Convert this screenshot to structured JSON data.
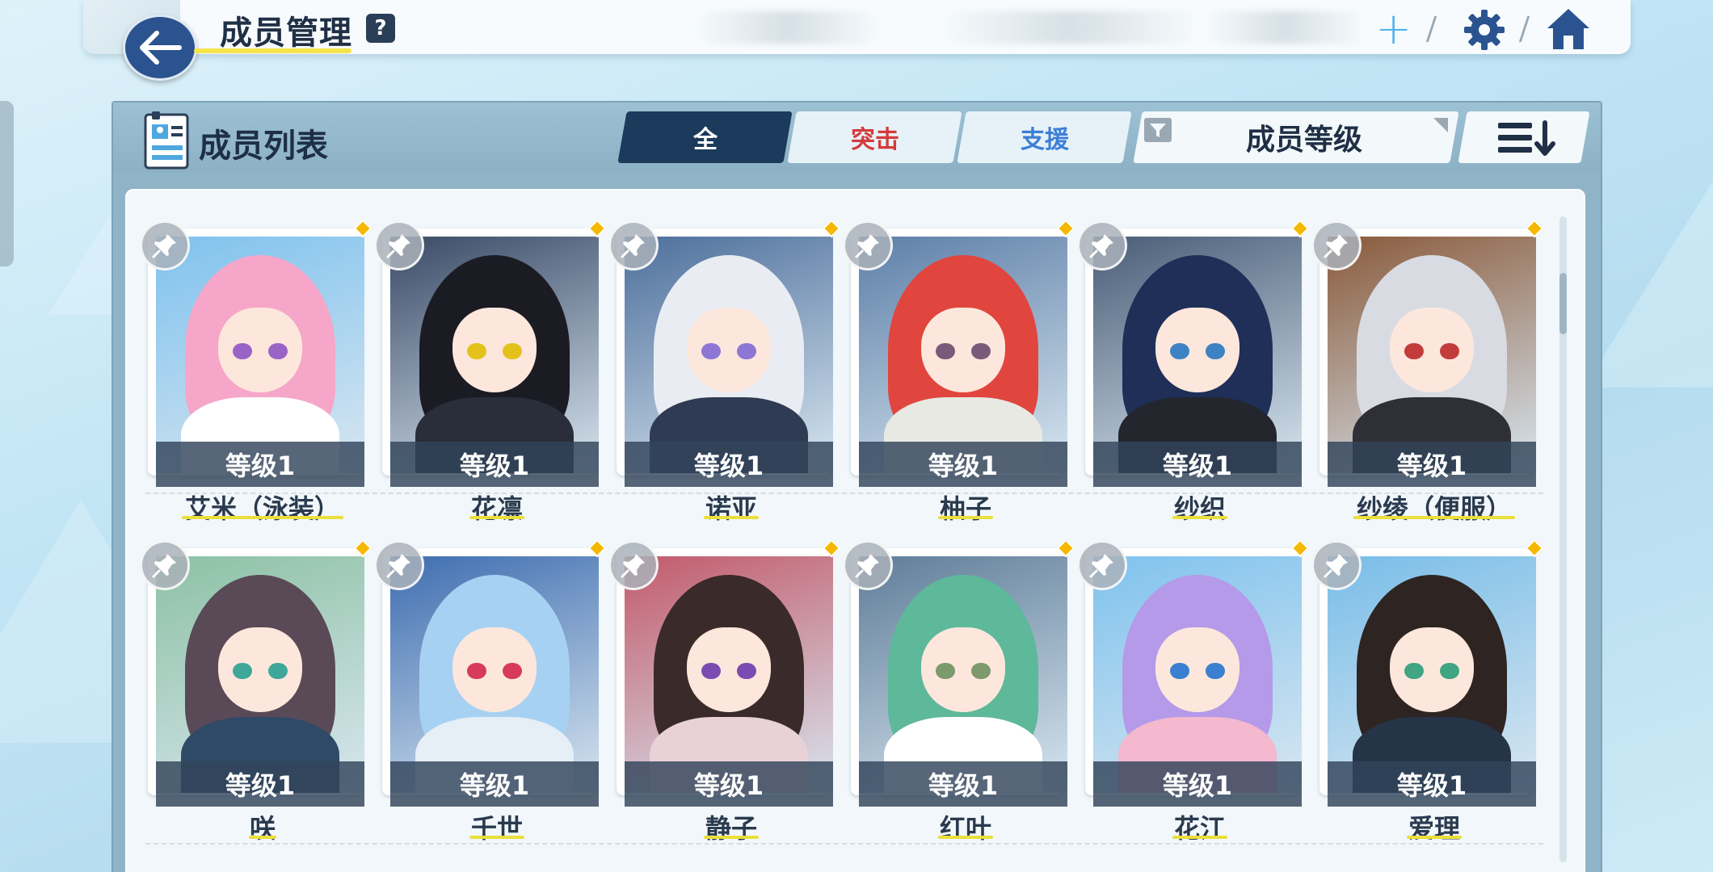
{
  "header": {
    "title": "成员管理",
    "help_label": "?",
    "plus_label": "+"
  },
  "panel": {
    "title": "成员列表",
    "tabs": [
      {
        "label": "全",
        "selected": true
      },
      {
        "label": "突击",
        "selected": false
      },
      {
        "label": "支援",
        "selected": false
      }
    ],
    "sort_label": "成员等级"
  },
  "colors": {
    "tab_selected": "#1b3a5c",
    "assault": "#d43b3b",
    "support": "#3d7fd6",
    "accent_yellow": "#f5b800"
  },
  "members": [
    {
      "name": "艾米（泳装）",
      "level": "等级1",
      "hair": "#f6a6c9",
      "bg": "#7fc2ee",
      "eye": "#9a63c6",
      "body": "#ffffff"
    },
    {
      "name": "花凛",
      "level": "等级1",
      "hair": "#1b1b24",
      "bg": "#3a4a66",
      "eye": "#e3c21c",
      "body": "#2a2e3a"
    },
    {
      "name": "诺亚",
      "level": "等级1",
      "hair": "#e9edf3",
      "bg": "#4d6f9c",
      "eye": "#8d76d4",
      "body": "#2f3b52"
    },
    {
      "name": "柚子",
      "level": "等级1",
      "hair": "#e0463e",
      "bg": "#5d7fa8",
      "eye": "#7a5a7a",
      "body": "#e9e9e4"
    },
    {
      "name": "纱织",
      "level": "等级1",
      "hair": "#1f2f58",
      "bg": "#4a5d77",
      "eye": "#3f82c4",
      "body": "#23262d"
    },
    {
      "name": "纱绫（便服）",
      "level": "等级1",
      "hair": "#d9dbe3",
      "bg": "#8a5a3b",
      "eye": "#c43b3b",
      "body": "#2f2f36"
    },
    {
      "name": "咲",
      "level": "等级1",
      "hair": "#5a4a58",
      "bg": "#8cc1a3",
      "eye": "#3fa79a",
      "body": "#2f4a66"
    },
    {
      "name": "千世",
      "level": "等级1",
      "hair": "#a7d1f2",
      "bg": "#3e6db0",
      "eye": "#d83a5b",
      "body": "#e6eef6"
    },
    {
      "name": "静子",
      "level": "等级1",
      "hair": "#3a2a2a",
      "bg": "#c25a6a",
      "eye": "#7a4bb0",
      "body": "#e8d2d8"
    },
    {
      "name": "红叶",
      "level": "等级1",
      "hair": "#5eb89a",
      "bg": "#5f7d99",
      "eye": "#7c9a6b",
      "body": "#ffffff"
    },
    {
      "name": "花江",
      "level": "等级1",
      "hair": "#b49ae9",
      "bg": "#7fc2ee",
      "eye": "#3b7fd0",
      "body": "#f4b8cf"
    },
    {
      "name": "爱理",
      "level": "等级1",
      "hair": "#2e2422",
      "bg": "#79bde8",
      "eye": "#3fa583",
      "body": "#263447"
    }
  ]
}
